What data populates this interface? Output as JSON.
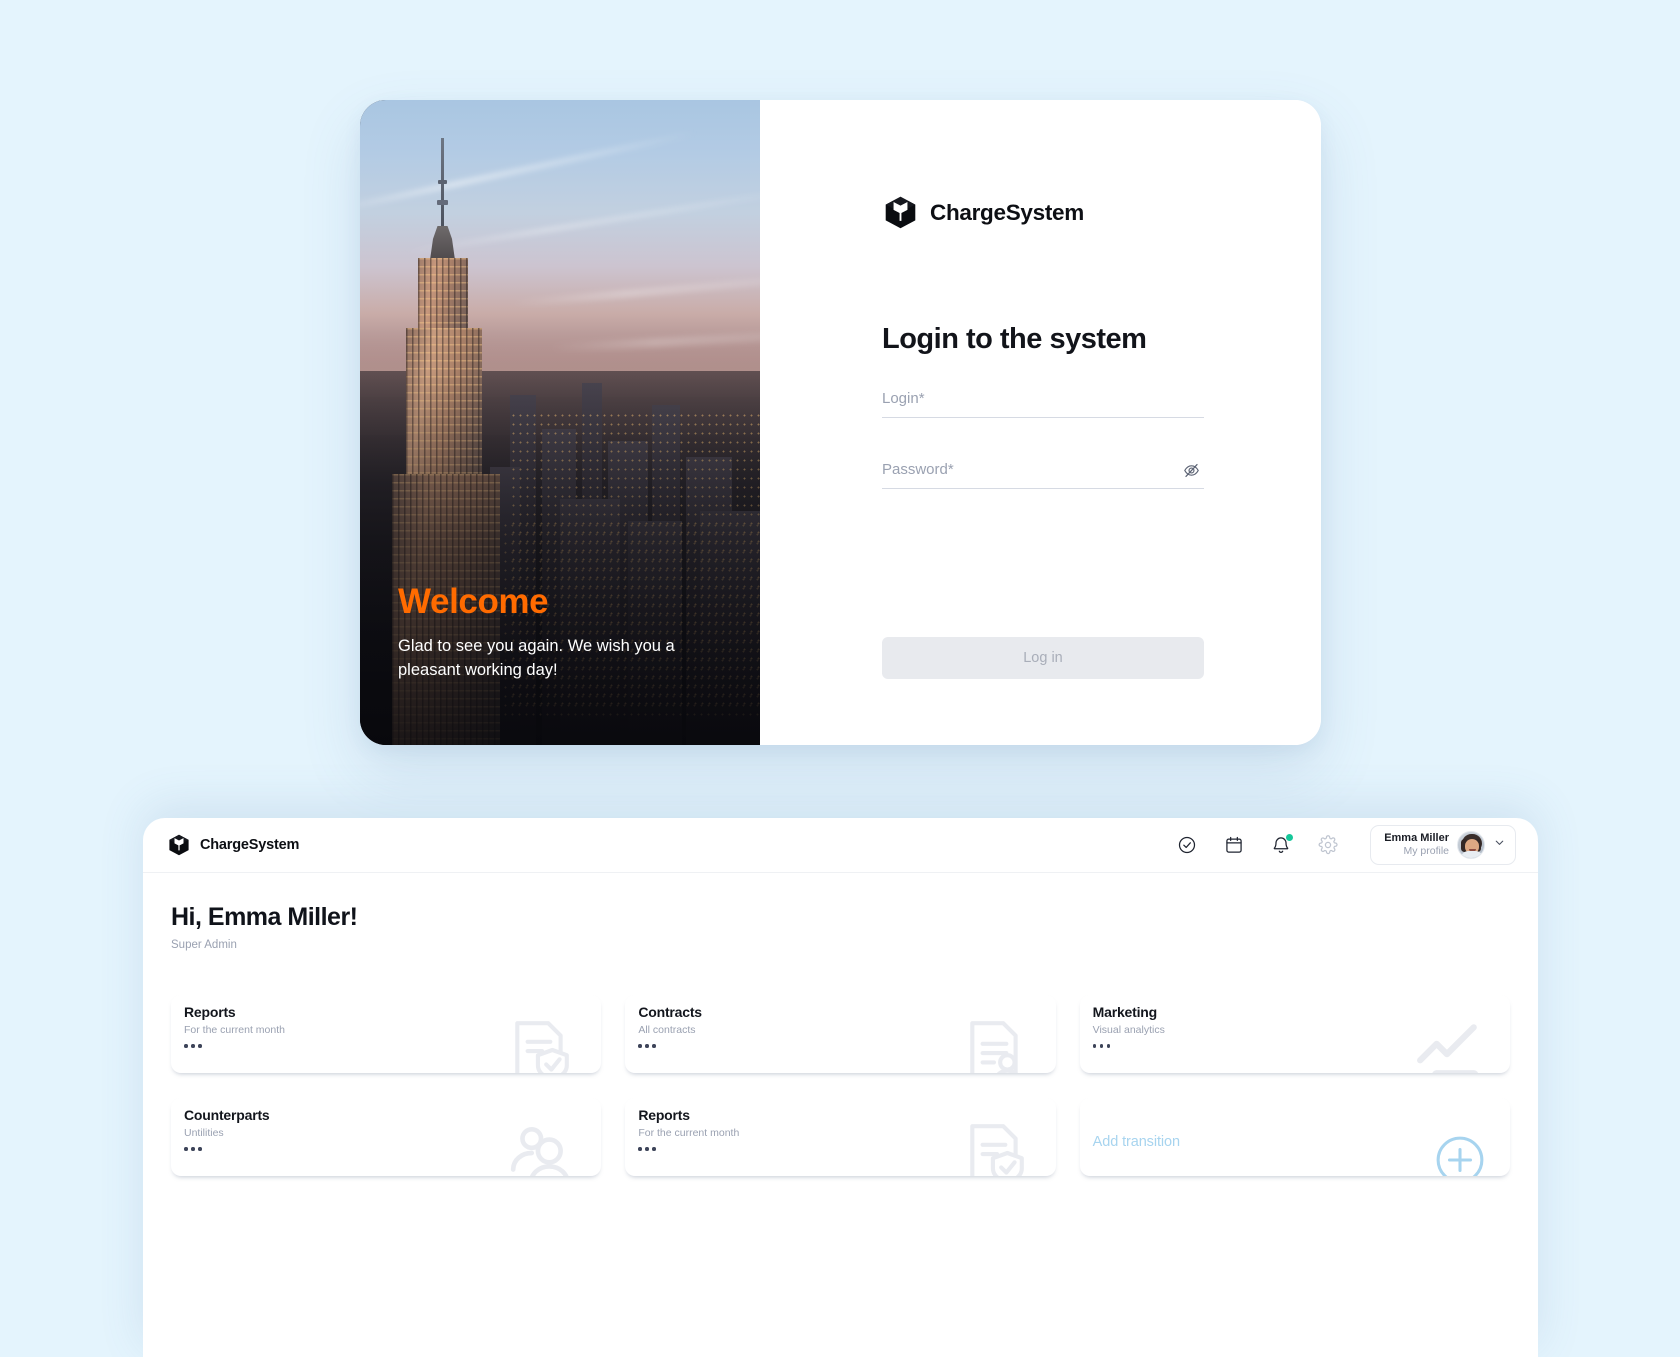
{
  "theme": {
    "page_background": "#E4F4FD",
    "accent_orange": "#FF6B00",
    "accent_light_blue": "#A7D4EF",
    "badge_green": "#16C79A",
    "text_dark": "#12141A",
    "text_muted": "#9AA1B1"
  },
  "login": {
    "brand": {
      "name": "ChargeSystem",
      "logo_icon": "cube-icon"
    },
    "hero": {
      "title": "Welcome",
      "subtitle": "Glad to see you again. We wish you a pleasant working day!",
      "image_description": "New York City skyline at dusk with the Empire State Building"
    },
    "heading": "Login to the system",
    "fields": [
      {
        "name": "login",
        "placeholder": "Login*",
        "value": "",
        "type": "text"
      },
      {
        "name": "password",
        "placeholder": "Password*",
        "value": "",
        "type": "password",
        "toggle_icon": "eye-off-icon"
      }
    ],
    "submit_label": "Log in",
    "submit_enabled": false
  },
  "dashboard": {
    "brand": {
      "name": "ChargeSystem",
      "logo_icon": "cube-icon"
    },
    "header_icons": [
      {
        "name": "tasks",
        "icon": "check-circle-icon",
        "badge": false
      },
      {
        "name": "calendar",
        "icon": "calendar-icon",
        "badge": false
      },
      {
        "name": "notifications",
        "icon": "bell-icon",
        "badge": true
      },
      {
        "name": "settings",
        "icon": "gear-icon",
        "badge": false
      }
    ],
    "profile": {
      "name": "Emma Miller",
      "link_label": "My profile",
      "avatar_icon": "avatar",
      "chevron_icon": "chevron-down-icon"
    },
    "greeting": "Hi, Emma Miller!",
    "role": "Super Admin",
    "cards": [
      {
        "title": "Reports",
        "subtitle": "For the current month",
        "icon": "document-shield-check-icon",
        "menu_icon": "ellipsis-icon"
      },
      {
        "title": "Contracts",
        "subtitle": "All contracts",
        "icon": "document-person-icon",
        "menu_icon": "ellipsis-icon"
      },
      {
        "title": "Marketing",
        "subtitle": "Visual analytics",
        "icon": "trending-up-chart-icon",
        "menu_icon": "ellipsis-icon"
      },
      {
        "title": "Counterparts",
        "subtitle": "Untilities",
        "icon": "people-icon",
        "menu_icon": "ellipsis-icon"
      },
      {
        "title": "Reports",
        "subtitle": "For the current month",
        "icon": "document-shield-check-icon",
        "menu_icon": "ellipsis-icon"
      }
    ],
    "add_card": {
      "label": "Add transition",
      "icon": "plus-circle-icon"
    }
  }
}
